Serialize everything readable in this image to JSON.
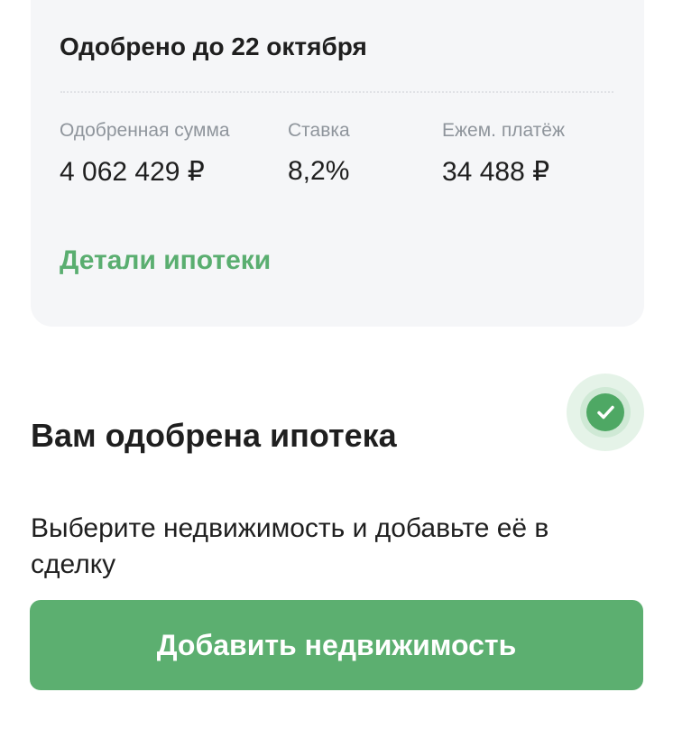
{
  "approval_card": {
    "title": "Одобрено до 22 октября",
    "metrics": [
      {
        "label": "Одобренная сумма",
        "value": "4 062 429 ₽"
      },
      {
        "label": "Ставка",
        "value": "8,2%"
      },
      {
        "label": "Ежем. платёж",
        "value": "34 488 ₽"
      }
    ],
    "details_link": "Детали ипотеки"
  },
  "approval_status": {
    "heading": "Вам одобрена ипотека",
    "icon": "check-circle-icon"
  },
  "description": "Выберите недвижимость и добавьте её в сделку",
  "primary_action": {
    "label": "Добавить недвижимость"
  },
  "colors": {
    "accent_green": "#5caf70",
    "card_background": "#f5f6f8",
    "muted_text": "#8f959c",
    "primary_text": "#1f1f1f"
  }
}
